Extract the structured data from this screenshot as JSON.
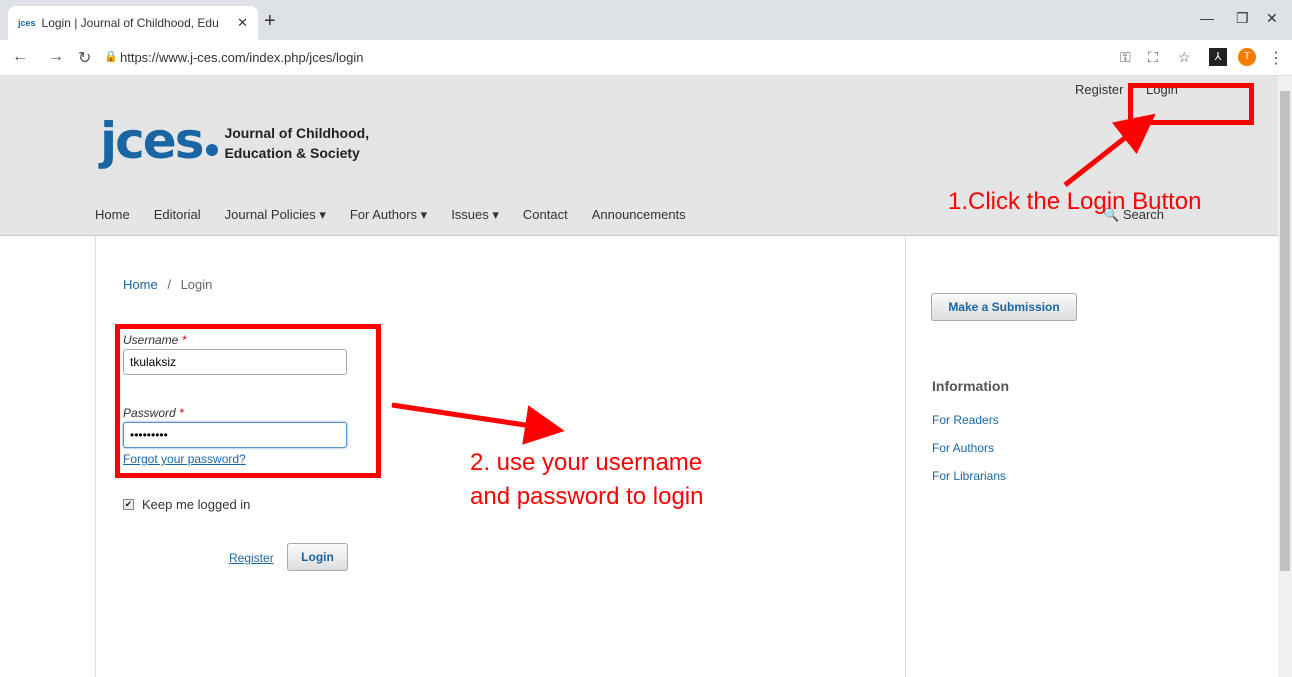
{
  "browser": {
    "tab_title": "Login | Journal of Childhood, Edu",
    "favicon_text": "jces",
    "url": "https://www.j-ces.com/index.php/jces/login",
    "profile_initial": "T"
  },
  "site": {
    "user_nav": {
      "register": "Register",
      "login": "Login"
    },
    "logo": {
      "main": "jces",
      "line1": "Journal of Childhood,",
      "line2": "Education & Society"
    },
    "nav": [
      "Home",
      "Editorial",
      "Journal Policies ▾",
      "For Authors ▾",
      "Issues ▾",
      "Contact",
      "Announcements"
    ],
    "search_label": "Search"
  },
  "breadcrumb": {
    "home": "Home",
    "sep": "/",
    "current": "Login"
  },
  "form": {
    "username_label": "Username",
    "username_value": "tkulaksiz",
    "password_label": "Password",
    "password_value": "•••••••••",
    "required_mark": "*",
    "forgot": "Forgot your password?",
    "remember": "Keep me logged in",
    "register": "Register",
    "login": "Login"
  },
  "sidebar": {
    "submit": "Make a Submission",
    "info_title": "Information",
    "links": [
      "For Readers",
      "For Authors",
      "For Librarians"
    ]
  },
  "annotations": {
    "step1": "1.Click the Login Button",
    "step2_line1": "2. use your username",
    "step2_line2": "and password to login",
    "color": "#ff0000"
  }
}
